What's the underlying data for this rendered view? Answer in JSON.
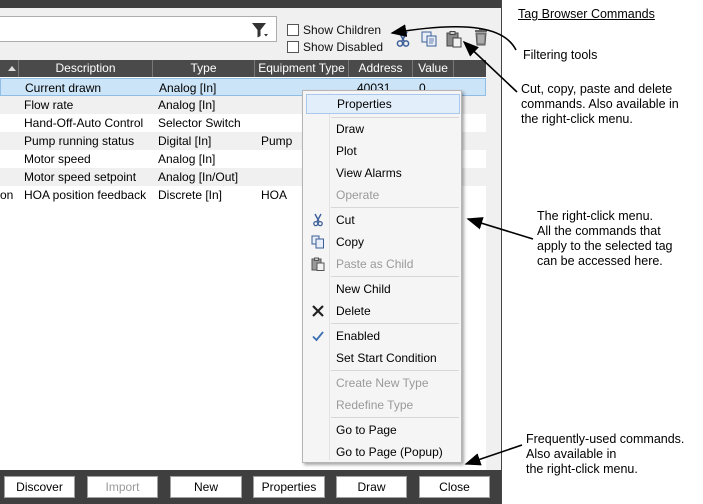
{
  "toolbar": {
    "show_children_label": "Show Children",
    "show_disabled_label": "Show Disabled",
    "show_children_checked": false,
    "show_disabled_checked": false
  },
  "grid": {
    "columns": [
      "Description",
      "Type",
      "Equipment Type",
      "Address",
      "Value"
    ],
    "rows": [
      {
        "prefix": "",
        "description": "Current drawn",
        "type": "Analog [In]",
        "equipment_type": "",
        "address": "40031",
        "value": "0"
      },
      {
        "prefix": "",
        "description": "Flow rate",
        "type": "Analog [In]",
        "equipment_type": "",
        "address": "",
        "value": ""
      },
      {
        "prefix": "",
        "description": "Hand-Off-Auto Control",
        "type": "Selector Switch",
        "equipment_type": "",
        "address": "",
        "value": ""
      },
      {
        "prefix": "",
        "description": "Pump running status",
        "type": "Digital [In]",
        "equipment_type": "Pump",
        "address": "",
        "value": ""
      },
      {
        "prefix": "",
        "description": "Motor speed",
        "type": "Analog [In]",
        "equipment_type": "",
        "address": "",
        "value": ""
      },
      {
        "prefix": "",
        "description": "Motor speed setpoint",
        "type": "Analog [In/Out]",
        "equipment_type": "",
        "address": "",
        "value": ""
      },
      {
        "prefix": "on",
        "description": "HOA position feedback",
        "type": "Discrete [In]",
        "equipment_type": "HOA",
        "address": "",
        "value": ""
      }
    ]
  },
  "context_menu": {
    "properties": "Properties",
    "draw": "Draw",
    "plot": "Plot",
    "view_alarms": "View Alarms",
    "operate": "Operate",
    "cut": "Cut",
    "copy": "Copy",
    "paste_as_child": "Paste as Child",
    "new_child": "New Child",
    "delete": "Delete",
    "enabled": "Enabled",
    "set_start_condition": "Set Start Condition",
    "create_new_type": "Create New Type",
    "redefine_type": "Redefine Type",
    "go_to_page": "Go to Page",
    "go_to_page_popup": "Go to Page (Popup)"
  },
  "buttons": {
    "discover": "Discover",
    "import": "Import",
    "new": "New",
    "properties": "Properties",
    "draw": "Draw",
    "close": "Close"
  },
  "annotations": {
    "title": "Tag Browser Commands",
    "filtering": "Filtering tools",
    "cut_copy": "Cut, copy, paste and delete\ncommands. Also available in\nthe right-click menu.",
    "right_click": "The right-click menu.\nAll the commands that\napply to the selected tag\ncan be accessed here.",
    "frequent": "Frequently-used commands.\nAlso available in\n  the right-click menu."
  },
  "colors": {
    "window_frame": "#3f3f3f",
    "header_bg": "#4a4a4a",
    "selected_row": "#cce4f7",
    "menu_highlight": "#e3eefb"
  }
}
